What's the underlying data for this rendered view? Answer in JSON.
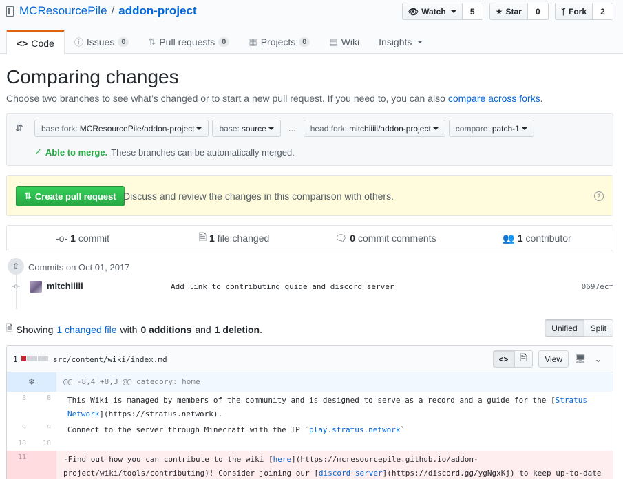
{
  "repo": {
    "owner": "MCResourcePile",
    "separator": "/",
    "name": "addon-project"
  },
  "actions": {
    "watch": {
      "label": "Watch",
      "count": "5"
    },
    "star": {
      "label": "Star",
      "count": "0"
    },
    "fork": {
      "label": "Fork",
      "count": "2"
    }
  },
  "nav": {
    "code": "Code",
    "issues": {
      "label": "Issues",
      "count": "0"
    },
    "pulls": {
      "label": "Pull requests",
      "count": "0"
    },
    "projects": {
      "label": "Projects",
      "count": "0"
    },
    "wiki": "Wiki",
    "insights": "Insights"
  },
  "compare": {
    "title": "Comparing changes",
    "subtitle": "Choose two branches to see what’s changed or to start a new pull request. If you need to, you can also",
    "subtitle_link": "compare across forks",
    "subtitle_end": ".",
    "base_fork": {
      "label": "base fork:",
      "value": "MCResourcePile/addon-project"
    },
    "base": {
      "label": "base:",
      "value": "source"
    },
    "dots": "...",
    "head_fork": {
      "label": "head fork:",
      "value": "mitchiiiii/addon-project"
    },
    "compare_branch": {
      "label": "compare:",
      "value": "patch-1"
    },
    "merge_ok": "Able to merge.",
    "merge_msg": "These branches can be automatically merged."
  },
  "create": {
    "button": "Create pull request",
    "text": "Discuss and review the changes in this comparison with others."
  },
  "numbers": {
    "commits": {
      "count": "1",
      "label": "commit"
    },
    "files": {
      "count": "1",
      "label": "file changed"
    },
    "comments": {
      "count": "0",
      "label": "commit comments"
    },
    "contributors": {
      "count": "1",
      "label": "contributor"
    }
  },
  "commits": {
    "group_title": "Commits on Oct 01, 2017",
    "items": [
      {
        "author": "mitchiiiii",
        "message": "Add link to contributing guide and discord server",
        "sha": "0697ecf"
      }
    ]
  },
  "toc": {
    "showing": "Showing",
    "changed_link": "1 changed file",
    "with": "with",
    "additions": "0 additions",
    "and": "and",
    "deletions": "1 deletion",
    "end": "."
  },
  "diff_mode": {
    "unified": "Unified",
    "split": "Split"
  },
  "file": {
    "count": "1",
    "path": "src/content/wiki/index.md",
    "view_label": "View",
    "hunk": "@@ -8,4 +8,3 @@ category: home",
    "lines": [
      {
        "old": "8",
        "new": "8",
        "type": "context",
        "pre": "This Wiki is managed by members of the community and is designed to serve as a record and a guide for the [",
        "link": "Stratus Network",
        "post": "](https://stratus.network)."
      },
      {
        "old": "9",
        "new": "9",
        "type": "context",
        "pre": "Connect to the server through Minecraft with the IP `",
        "link": "play.stratus.network",
        "post": "`"
      },
      {
        "old": "10",
        "new": "10",
        "type": "context",
        "pre": "",
        "link": "",
        "post": ""
      },
      {
        "old": "11",
        "new": "",
        "type": "deletion",
        "pre": "-Find out how you can contribute to the wiki [",
        "link": "here",
        "mid": "](https://mcresourcepile.github.io/addon-project/wiki/tools/contributing)! Consider joining our [",
        "link2": "discord server",
        "post": "](https://discord.gg/ygNgxKj) to keep up-to-date with other contributors and new updates."
      }
    ]
  },
  "colors": {
    "accent": "#0366d6",
    "success": "#28a745",
    "deletion": "#cb2431",
    "tab_highlight": "#e36209"
  }
}
